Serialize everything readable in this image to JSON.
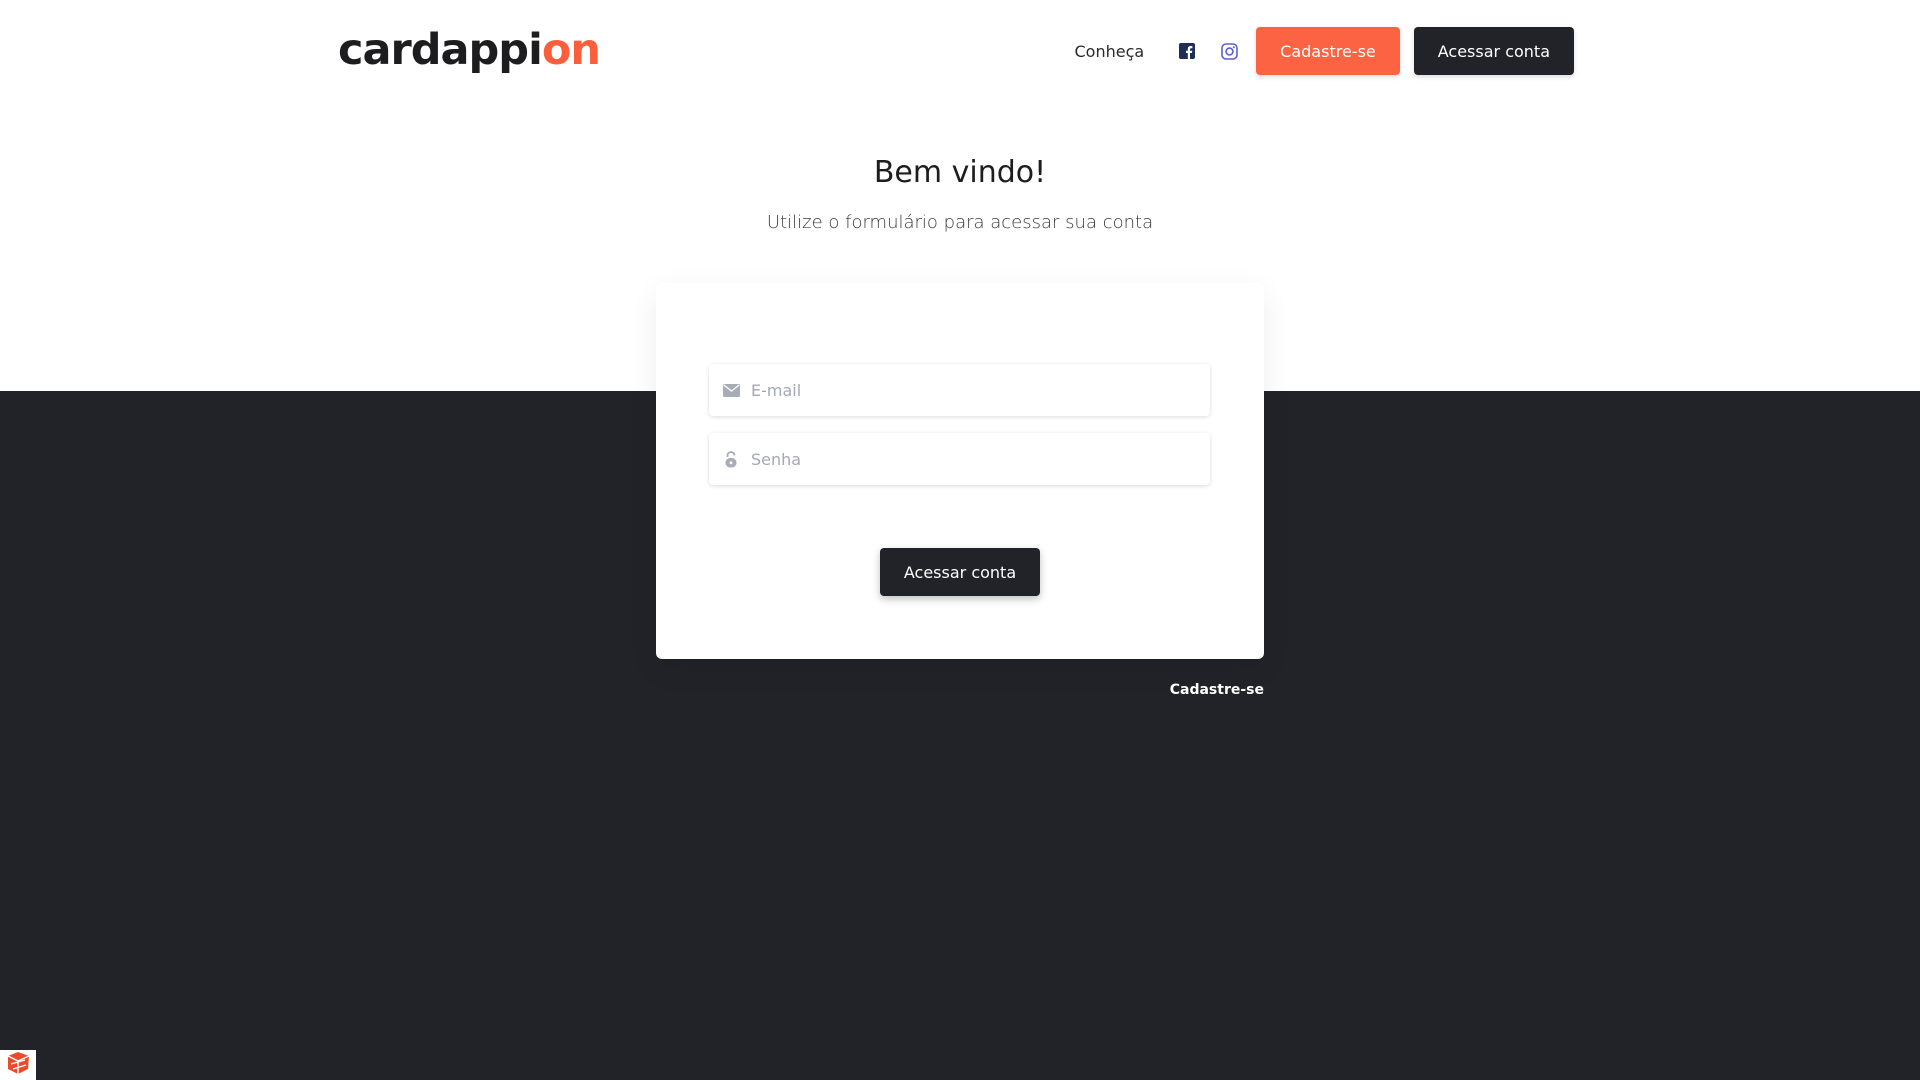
{
  "header": {
    "logo_main": "cardappi",
    "logo_accent": "on",
    "nav_link": "Conheça",
    "social": [
      "facebook-icon",
      "instagram-icon"
    ],
    "signup_button": "Cadastre-se",
    "login_button": "Acessar conta"
  },
  "hero": {
    "title": "Bem vindo!",
    "subtitle": "Utilize o formulário para acessar sua conta"
  },
  "form": {
    "email_placeholder": "E-mail",
    "email_value": "",
    "password_placeholder": "Senha",
    "password_value": "",
    "submit_label": "Acessar conta"
  },
  "footer_link": "Cadastre-se",
  "colors": {
    "accent": "#fb6342",
    "dark": "#212329",
    "facebook": "#1f2d5a",
    "instagram": "#5b5fd6"
  }
}
